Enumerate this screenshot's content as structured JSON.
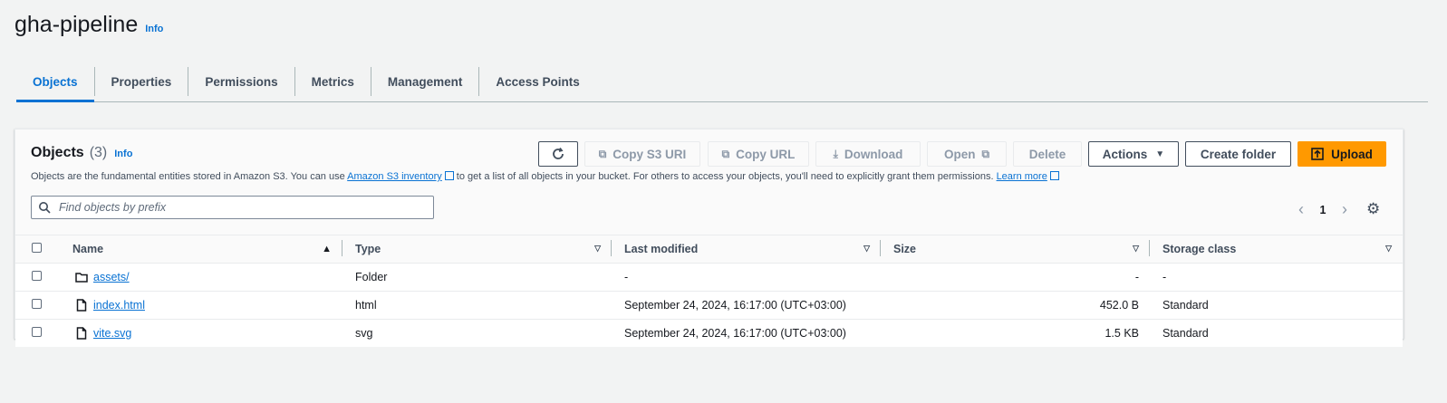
{
  "page": {
    "title": "gha-pipeline",
    "info": "Info"
  },
  "tabs": [
    "Objects",
    "Properties",
    "Permissions",
    "Metrics",
    "Management",
    "Access Points"
  ],
  "panel": {
    "title": "Objects",
    "count": "(3)",
    "info": "Info",
    "description": {
      "part1": "Objects are the fundamental entities stored in Amazon S3. You can use ",
      "link1": "Amazon S3 inventory",
      "part2": " to get a list of all objects in your bucket. For others to access your objects, you'll need to explicitly grant them permissions. ",
      "link2": "Learn more"
    }
  },
  "toolbar": {
    "copy_s3_uri": "Copy S3 URI",
    "copy_url": "Copy URL",
    "download": "Download",
    "open": "Open",
    "delete": "Delete",
    "actions": "Actions",
    "create_folder": "Create folder",
    "upload": "Upload"
  },
  "search": {
    "placeholder": "Find objects by prefix"
  },
  "pagination": {
    "current_page": "1"
  },
  "table": {
    "headers": [
      "Name",
      "Type",
      "Last modified",
      "Size",
      "Storage class"
    ],
    "rows": [
      {
        "name": "assets/",
        "icon": "folder-icon",
        "type": "Folder",
        "last_modified": "-",
        "size": "-",
        "storage_class": "-"
      },
      {
        "name": "index.html",
        "icon": "file-icon",
        "type": "html",
        "last_modified": "September 24, 2024, 16:17:00 (UTC+03:00)",
        "size": "452.0 B",
        "storage_class": "Standard"
      },
      {
        "name": "vite.svg",
        "icon": "file-icon",
        "type": "svg",
        "last_modified": "September 24, 2024, 16:17:00 (UTC+03:00)",
        "size": "1.5 KB",
        "storage_class": "Standard"
      }
    ]
  },
  "colors": {
    "accent": "#0972d3",
    "primary_button": "#ff9900",
    "background": "#f2f3f3"
  }
}
